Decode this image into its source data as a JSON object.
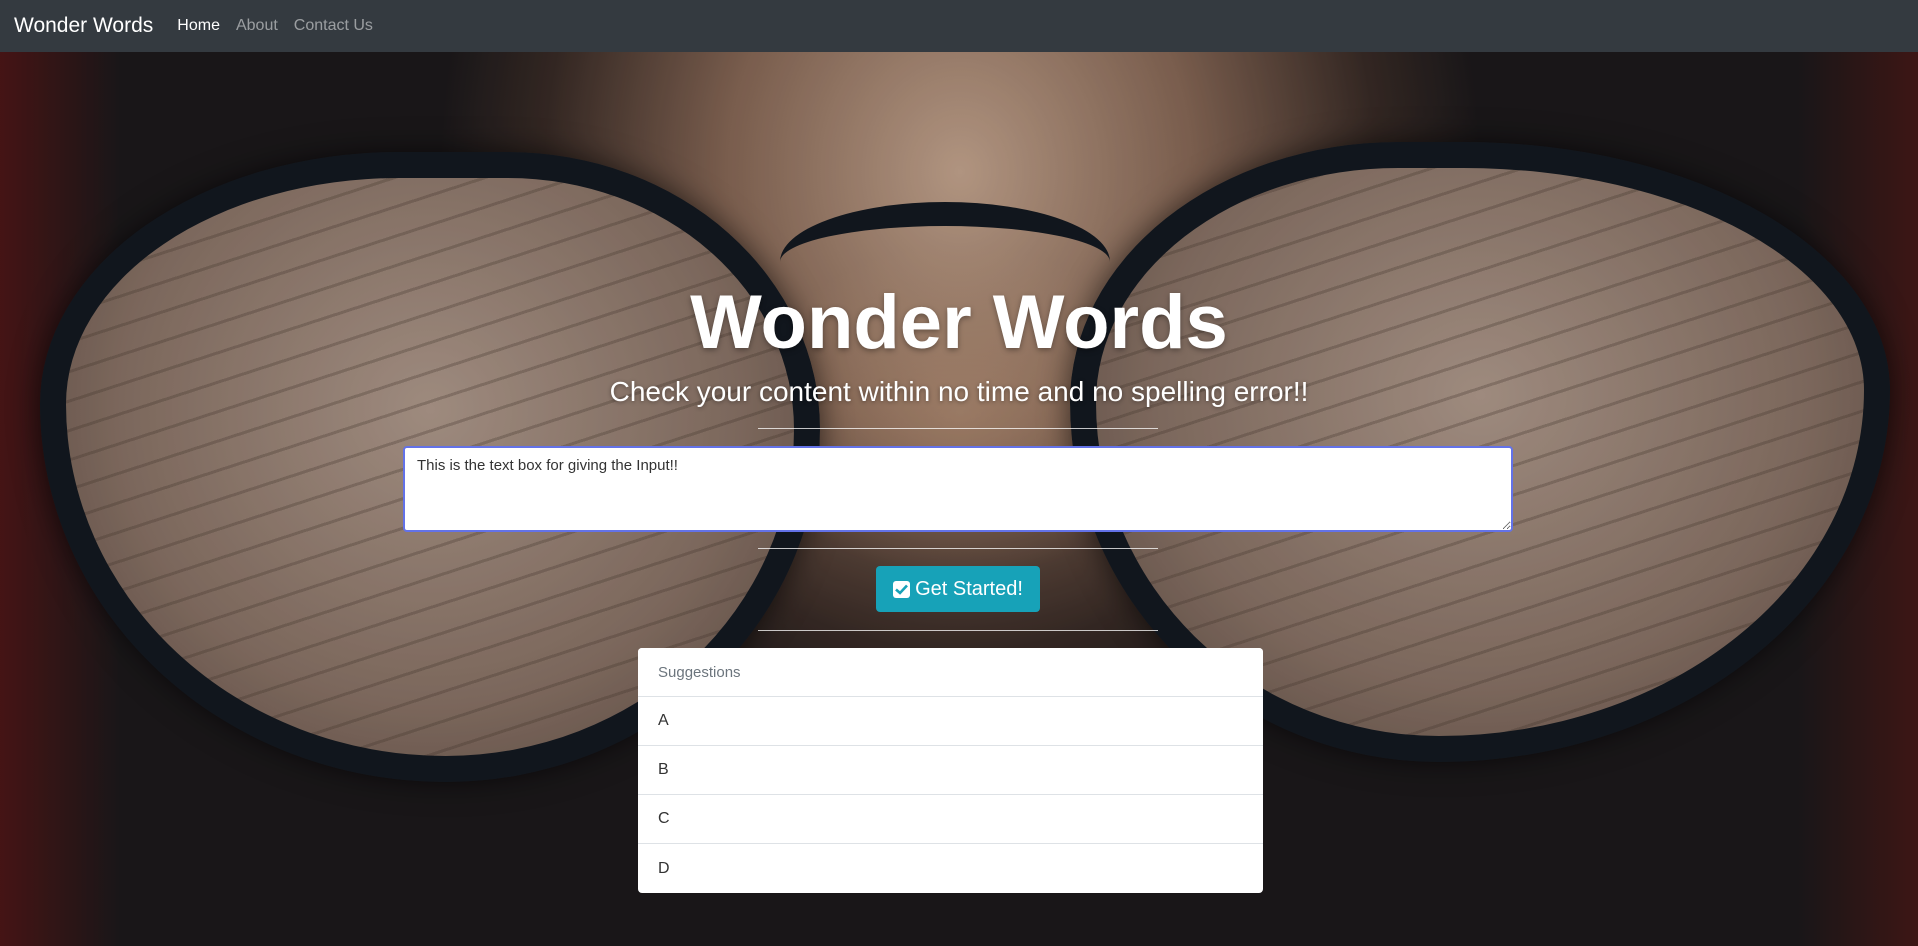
{
  "navbar": {
    "brand": "Wonder Words",
    "links": [
      {
        "label": "Home",
        "active": true
      },
      {
        "label": "About",
        "active": false
      },
      {
        "label": "Contact Us",
        "active": false
      }
    ]
  },
  "hero": {
    "title": "Wonder Words",
    "subtitle": "Check your content within no time and no spelling error!!",
    "input_value": "This is the text box for giving the Input!!",
    "button_label": "Get Started!",
    "button_icon": "check-square-icon"
  },
  "suggestions": {
    "header": "Suggestions",
    "items": [
      "A",
      "B",
      "C",
      "D"
    ]
  },
  "colors": {
    "navbar_bg": "#343a40",
    "button_bg": "#17a2b8",
    "input_border": "#6372e8"
  }
}
